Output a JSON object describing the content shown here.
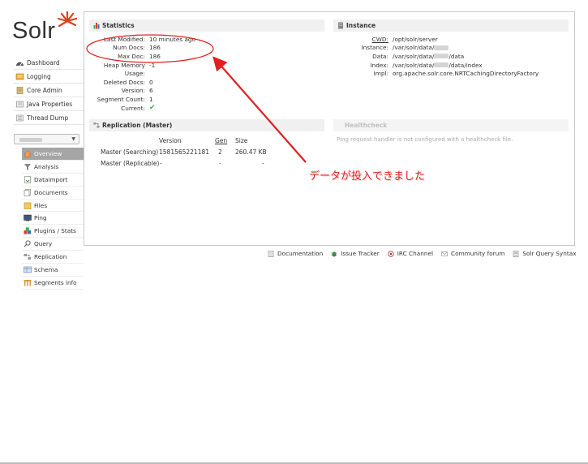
{
  "logo": {
    "text": "Solr"
  },
  "nav": [
    {
      "label": "Dashboard",
      "icon": "dashboard-icon"
    },
    {
      "label": "Logging",
      "icon": "logging-icon"
    },
    {
      "label": "Core Admin",
      "icon": "core-admin-icon"
    },
    {
      "label": "Java Properties",
      "icon": "java-properties-icon"
    },
    {
      "label": "Thread Dump",
      "icon": "thread-dump-icon"
    }
  ],
  "core_selector": {
    "value": "",
    "caret": "▼"
  },
  "core_nav": [
    {
      "label": "Overview",
      "icon": "home-icon"
    },
    {
      "label": "Analysis",
      "icon": "analysis-icon"
    },
    {
      "label": "Dataimport",
      "icon": "dataimport-icon"
    },
    {
      "label": "Documents",
      "icon": "documents-icon"
    },
    {
      "label": "Files",
      "icon": "files-icon"
    },
    {
      "label": "Ping",
      "icon": "ping-icon"
    },
    {
      "label": "Plugins / Stats",
      "icon": "plugins-icon"
    },
    {
      "label": "Query",
      "icon": "query-icon"
    },
    {
      "label": "Replication",
      "icon": "replication-icon"
    },
    {
      "label": "Schema",
      "icon": "schema-icon"
    },
    {
      "label": "Segments info",
      "icon": "segments-icon"
    }
  ],
  "statistics": {
    "title": "Statistics",
    "rows": [
      {
        "k": "Last Modified:",
        "v": "10 minutes ago"
      },
      {
        "k": "Num Docs:",
        "v": "186"
      },
      {
        "k": "Max Doc:",
        "v": "186"
      },
      {
        "k": "Heap Memory",
        "v": "-1"
      },
      {
        "k": "Usage:",
        "v": ""
      },
      {
        "k": "Deleted Docs:",
        "v": "0"
      },
      {
        "k": "Version:",
        "v": "6"
      },
      {
        "k": "Segment Count:",
        "v": "1"
      },
      {
        "k": "Current:",
        "v": "✔"
      }
    ]
  },
  "instance": {
    "title": "Instance",
    "rows": [
      {
        "k": "CWD:",
        "v": "/opt/solr/server",
        "v2": ""
      },
      {
        "k": "Instance:",
        "v": "/var/solr/data/",
        "v2": ""
      },
      {
        "k": "Data:",
        "v": "/var/solr/data/",
        "v2": "/data"
      },
      {
        "k": "Index:",
        "v": "/var/solr/data/",
        "v2": "/data/index"
      },
      {
        "k": "Impl:",
        "v": "org.apache.solr.core.NRTCachingDirectoryFactory",
        "v2": ""
      }
    ]
  },
  "replication": {
    "title": "Replication (Master)",
    "headers": [
      "Version",
      "Gen",
      "Size"
    ],
    "rows": [
      {
        "name": "Master (Searching)",
        "version": "1581565221181",
        "gen": "2",
        "size": "260.47 KB"
      },
      {
        "name": "Master (Replicable)",
        "version": "-",
        "gen": "-",
        "size": "-"
      }
    ]
  },
  "healthcheck": {
    "title": "Healthcheck",
    "message": "Ping request handler is not configured with a healthcheck file."
  },
  "footer": [
    {
      "label": "Documentation",
      "icon": "documentation-icon"
    },
    {
      "label": "Issue Tracker",
      "icon": "bug-icon"
    },
    {
      "label": "IRC Channel",
      "icon": "irc-icon"
    },
    {
      "label": "Community forum",
      "icon": "mail-icon"
    },
    {
      "label": "Solr Query Syntax",
      "icon": "query-syntax-icon"
    }
  ],
  "annotation": {
    "text": "データが投入できました",
    "color": "#e02020"
  },
  "colors": {
    "accent": "#d9411e",
    "active_nav": "#a5a5a5",
    "check": "#3cb043"
  }
}
